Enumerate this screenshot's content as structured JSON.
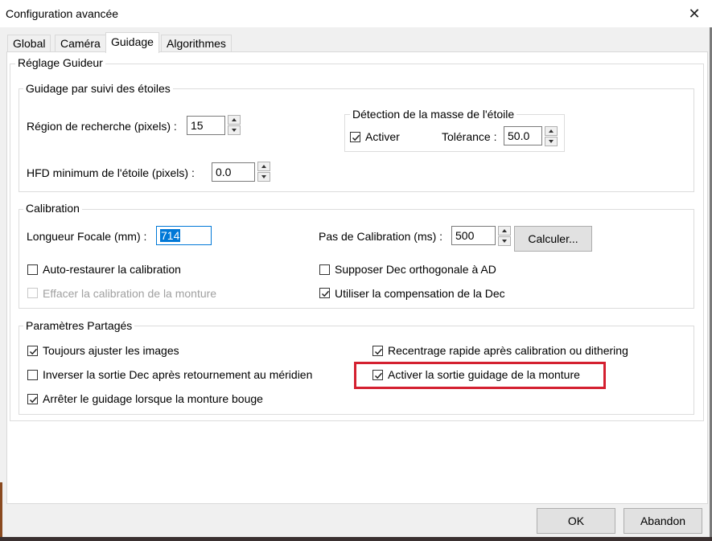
{
  "window": {
    "title": "Configuration avancée",
    "close_glyph": "✕"
  },
  "tabs": [
    {
      "label": "Global"
    },
    {
      "label": "Caméra"
    },
    {
      "label": "Guidage",
      "active": true
    },
    {
      "label": "Algorithmes"
    }
  ],
  "guider_settings": {
    "title": "Réglage Guideur",
    "star_tracking": {
      "title": "Guidage par suivi des étoiles",
      "search_region_label": "Région de recherche (pixels) :",
      "search_region_value": "15",
      "min_hfd_label": "HFD minimum de l'étoile (pixels) :",
      "min_hfd_value": "0.0",
      "mass_detection": {
        "title": "Détection de la masse de l'étoile",
        "enable_label": "Activer",
        "enable_checked": true,
        "tolerance_label": "Tolérance :",
        "tolerance_value": "50.0"
      }
    },
    "calibration": {
      "title": "Calibration",
      "focal_length_label": "Longueur Focale (mm) :",
      "focal_length_value": "714",
      "step_label": "Pas de Calibration (ms) :",
      "step_value": "500",
      "calculate_label": "Calculer...",
      "auto_restore_label": "Auto-restaurer la calibration",
      "auto_restore_checked": false,
      "clear_mount_label": "Effacer la calibration de la monture",
      "clear_mount_checked": false,
      "clear_mount_disabled": true,
      "assume_ortho_label": "Supposer Dec orthogonale à AD",
      "assume_ortho_checked": false,
      "dec_comp_label": "Utiliser la compensation de la Dec",
      "dec_comp_checked": true
    },
    "shared": {
      "title": "Paramètres Partagés",
      "always_scale_label": "Toujours ajuster les images",
      "always_scale_checked": true,
      "reverse_dec_label": "Inverser la sortie Dec après retournement au méridien",
      "reverse_dec_checked": false,
      "stop_guiding_label": "Arrêter le guidage lorsque la monture bouge",
      "stop_guiding_checked": true,
      "fast_recenter_label": "Recentrage rapide après calibration ou dithering",
      "fast_recenter_checked": true,
      "enable_mount_output_label": "Activer la sortie guidage de la monture",
      "enable_mount_output_checked": true
    }
  },
  "footer": {
    "ok_label": "OK",
    "cancel_label": "Abandon"
  },
  "colors": {
    "highlight": "#d42030",
    "selection": "#0078d7"
  }
}
